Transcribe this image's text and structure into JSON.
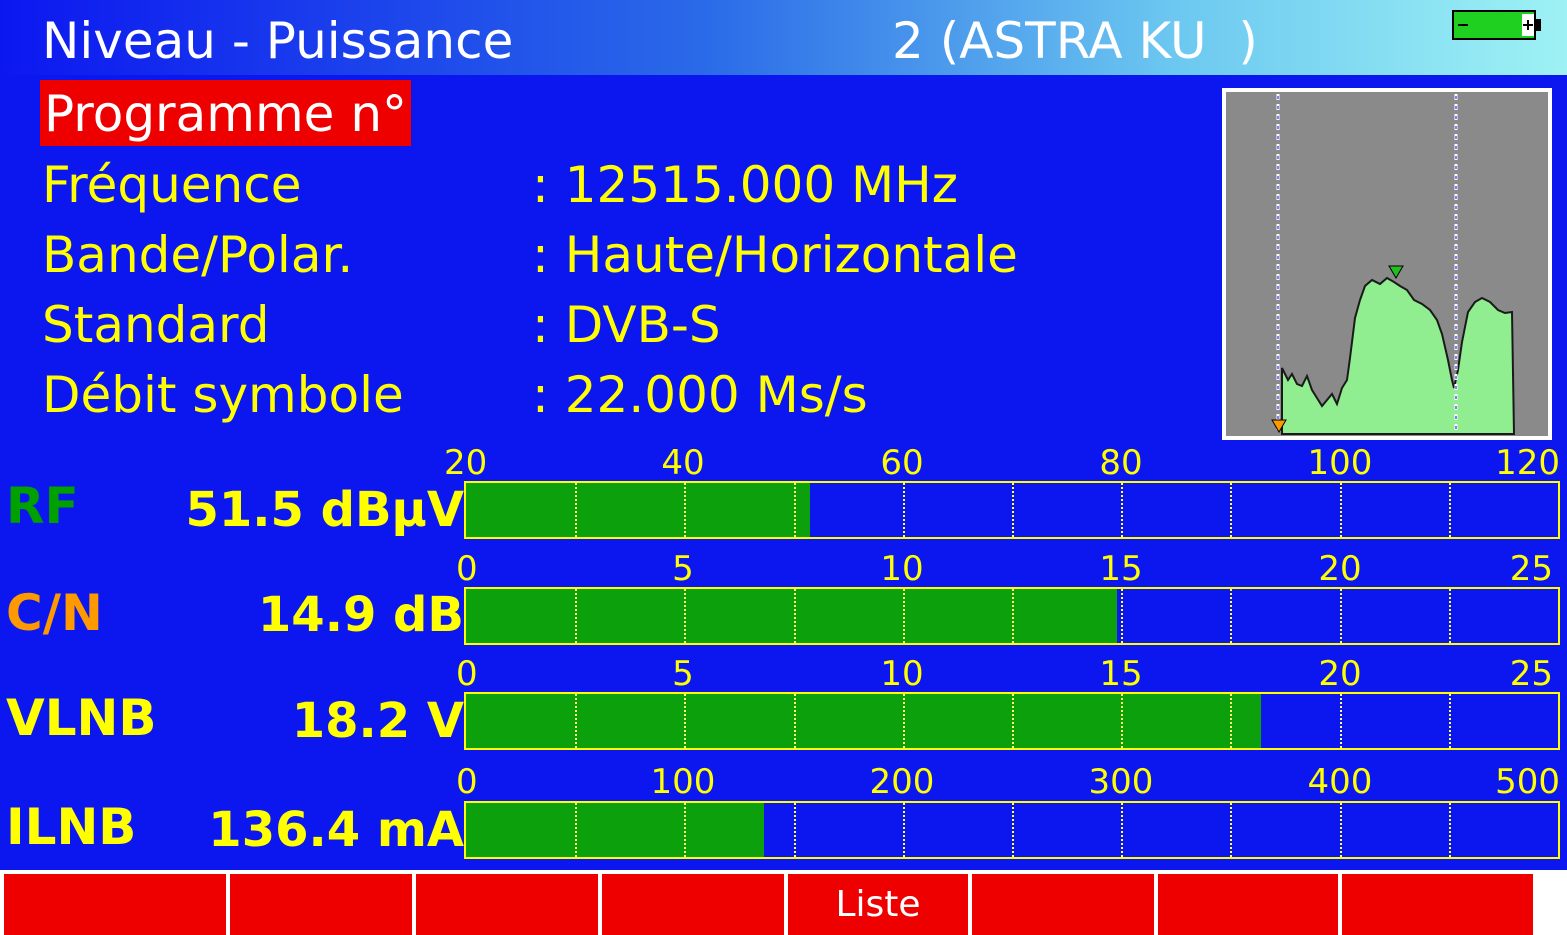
{
  "header": {
    "title": "Niveau - Puissance",
    "satellite": "2 (ASTRA KU  )",
    "battery_icon": "battery-icon"
  },
  "program": {
    "label": "Programme n°"
  },
  "info": [
    {
      "label": "Fréquence",
      "value": ": 12515.000 MHz"
    },
    {
      "label": "Bande/Polar.",
      "value": ": Haute/Horizontale"
    },
    {
      "label": "Standard",
      "value": ": DVB-S"
    },
    {
      "label": "Débit symbole",
      "value": ": 22.000 Ms/s"
    }
  ],
  "meters": [
    {
      "name": "RF",
      "name_color": "#00a000",
      "value": "51.5 dBµV",
      "ticks": [
        "20",
        "40",
        "60",
        "80",
        "100",
        "120"
      ],
      "min": 20,
      "max": 120,
      "level": 51.5
    },
    {
      "name": "C/N",
      "name_color": "#ff9900",
      "value": "14.9 dB",
      "ticks": [
        "0",
        "5",
        "10",
        "15",
        "20",
        "25"
      ],
      "min": 0,
      "max": 25,
      "level": 14.9
    },
    {
      "name": "VLNB",
      "name_color": "#ffff00",
      "value": "18.2 V",
      "ticks": [
        "0",
        "5",
        "10",
        "15",
        "20",
        "25"
      ],
      "min": 0,
      "max": 25,
      "level": 18.2
    },
    {
      "name": "ILNB",
      "name_color": "#ffff00",
      "value": "136.4 mA",
      "ticks": [
        "0",
        "100",
        "200",
        "300",
        "400",
        "500"
      ],
      "min": 0,
      "max": 500,
      "level": 136.4
    }
  ],
  "function_keys": [
    "",
    "",
    "",
    "",
    "Liste",
    "",
    "",
    ""
  ],
  "colors": {
    "background": "#0c17f0",
    "text": "#ffff00",
    "bar_fill": "#0ca00c",
    "highlight": "#ee0000",
    "spectrum_fill": "#90ee90"
  }
}
